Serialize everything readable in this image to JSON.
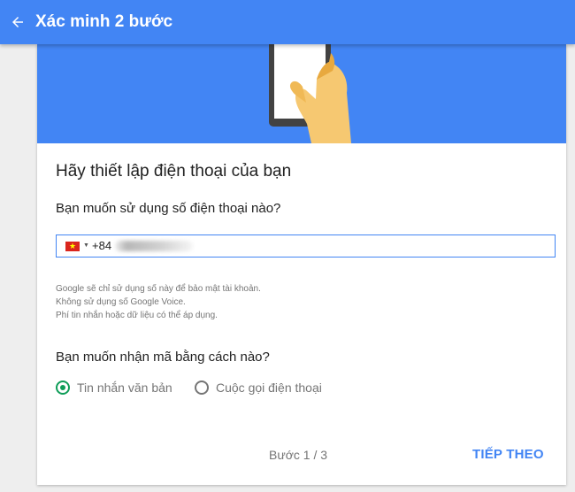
{
  "header": {
    "title": "Xác minh 2 bước",
    "back_icon": "arrow-left-icon"
  },
  "hero": {
    "illustration": "hand-holding-phone-icon",
    "colors": {
      "background": "#4285f4",
      "hand": "#f6c871",
      "phone": "#424242"
    }
  },
  "main": {
    "heading": "Hãy thiết lập điện thoại của bạn",
    "phone_question": "Bạn muốn sử dụng số điện thoại nào?",
    "phone_input": {
      "flag": "vietnam-flag-icon",
      "country_code": "+84"
    },
    "notes": [
      "Google sẽ chỉ sử dụng số này để bảo mật tài khoản.",
      "Không sử dụng số Google Voice.",
      "Phí tin nhắn hoặc dữ liệu có thể áp dụng."
    ],
    "method_question": "Bạn muốn nhận mã bằng cách nào?",
    "methods": [
      {
        "label": "Tin nhắn văn bản",
        "selected": true
      },
      {
        "label": "Cuộc gọi điện thoại",
        "selected": false
      }
    ]
  },
  "footer": {
    "step": "Bước 1 / 3",
    "next_label": "TIẾP THEO"
  },
  "colors": {
    "accent": "#4285f4",
    "radio_selected": "#0f9d58",
    "text_primary": "#212121",
    "text_secondary": "#757575"
  }
}
